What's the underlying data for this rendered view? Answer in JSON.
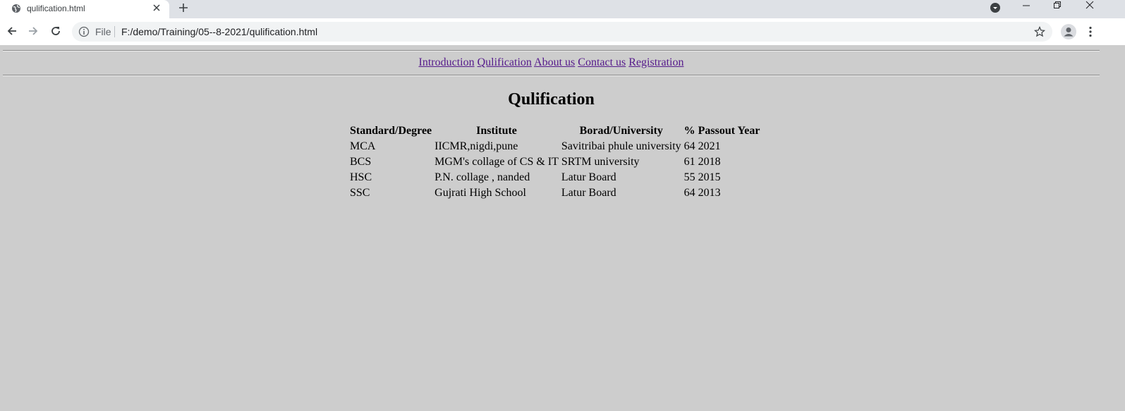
{
  "browser": {
    "tab_title": "qulification.html",
    "url_scheme": "File",
    "url": "F:/demo/Training/05--8-2021/qulification.html"
  },
  "nav": {
    "links": [
      "Introduction",
      "Qulification",
      "About us",
      "Contact us",
      "Registration"
    ]
  },
  "page_title": "Qulification",
  "table": {
    "headers": [
      "Standard/Degree",
      "Institute",
      "Borad/University",
      "%",
      "Passout Year"
    ],
    "rows": [
      [
        "MCA",
        "IICMR,nigdi,pune",
        "Savitribai phule university",
        "64",
        "2021"
      ],
      [
        "BCS",
        "MGM's collage of CS & IT",
        "SRTM university",
        "61",
        "2018"
      ],
      [
        "HSC",
        "P.N. collage , nanded",
        "Latur Board",
        "55",
        "2015"
      ],
      [
        "SSC",
        "Gujrati High School",
        "Latur Board",
        "64",
        "2013"
      ]
    ]
  },
  "colors": {
    "page_background": "#cdcdcd",
    "visited_link": "#551a8b"
  },
  "icons": [
    "globe-icon",
    "close-icon",
    "plus-icon",
    "profile-dropdown-icon",
    "minimize-icon",
    "restore-icon",
    "close-window-icon",
    "back-icon",
    "forward-icon",
    "reload-icon",
    "info-icon",
    "star-icon",
    "avatar-icon",
    "more-menu-icon"
  ]
}
